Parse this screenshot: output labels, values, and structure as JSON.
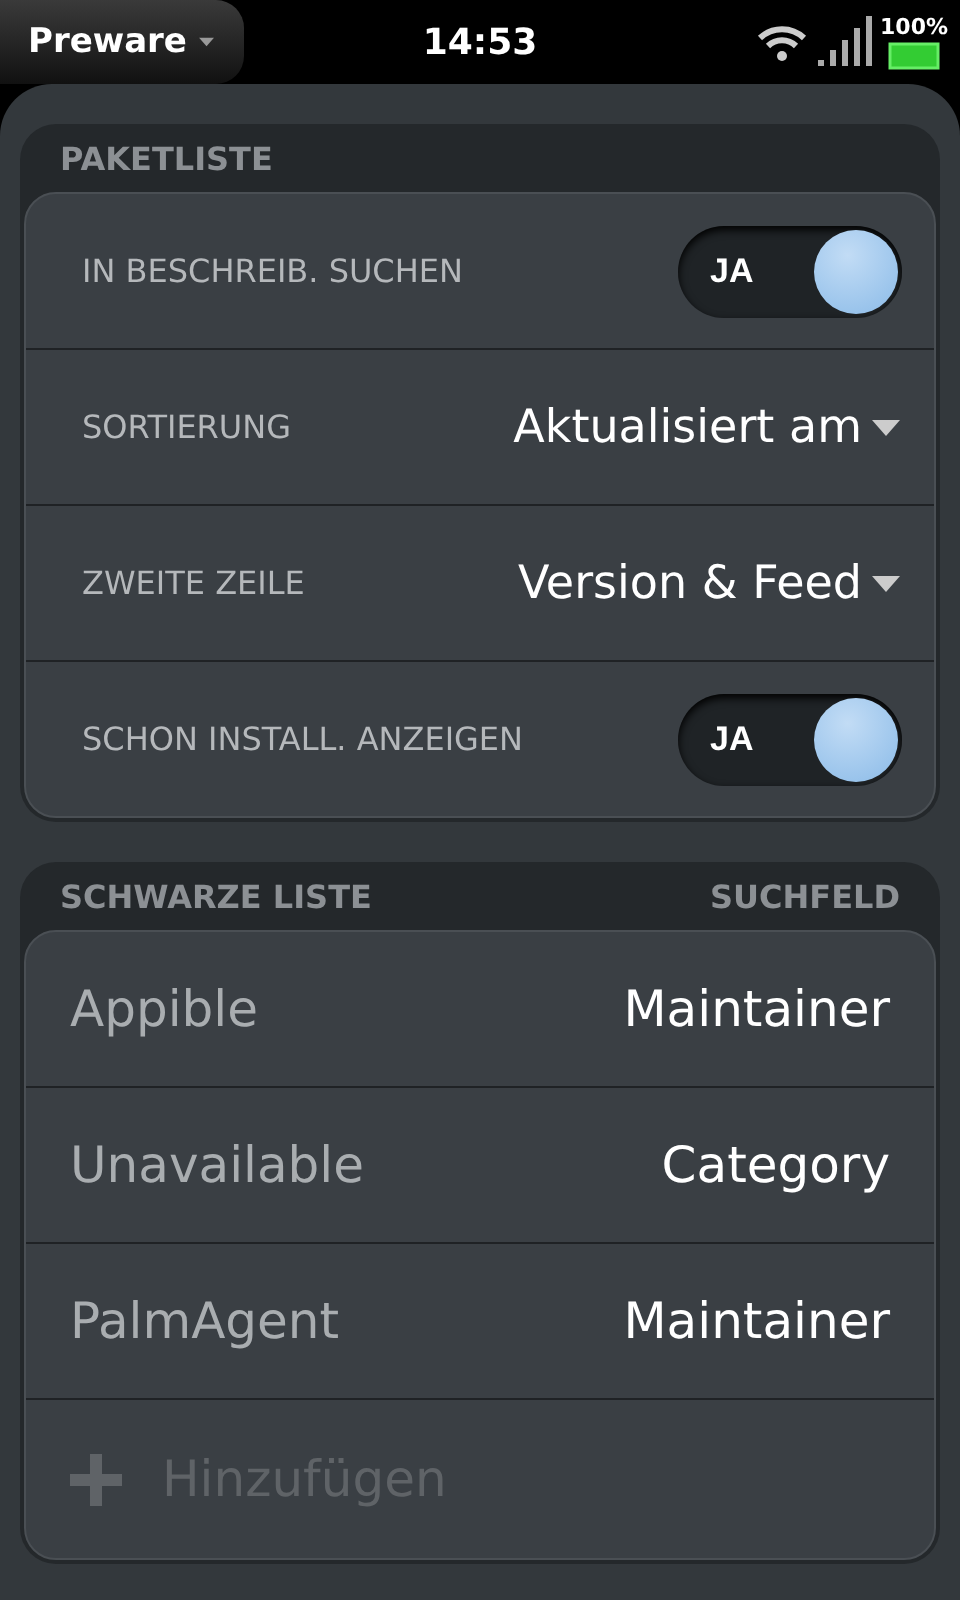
{
  "status_bar": {
    "app_menu": "Preware",
    "time": "14:53",
    "battery": "100%"
  },
  "package_list": {
    "title": "PAKETLISTE",
    "rows": [
      {
        "kind": "toggle",
        "label": "IN BESCHREIB. SUCHEN",
        "toggle_label": "JA",
        "on": true
      },
      {
        "kind": "select",
        "label": "SORTIERUNG",
        "value": "Aktualisiert am"
      },
      {
        "kind": "select",
        "label": "ZWEITE ZEILE",
        "value": "Version & Feed"
      },
      {
        "kind": "toggle",
        "label": "SCHON INSTALL. ANZEIGEN",
        "toggle_label": "JA",
        "on": true
      }
    ]
  },
  "blacklist": {
    "title": "SCHWARZE LISTE",
    "column_header": "SUCHFELD",
    "rows": [
      {
        "name": "Appible",
        "field": "Maintainer"
      },
      {
        "name": "Unavailable",
        "field": "Category"
      },
      {
        "name": "PalmAgent",
        "field": "Maintainer"
      }
    ],
    "add_label": "Hinzufügen"
  }
}
